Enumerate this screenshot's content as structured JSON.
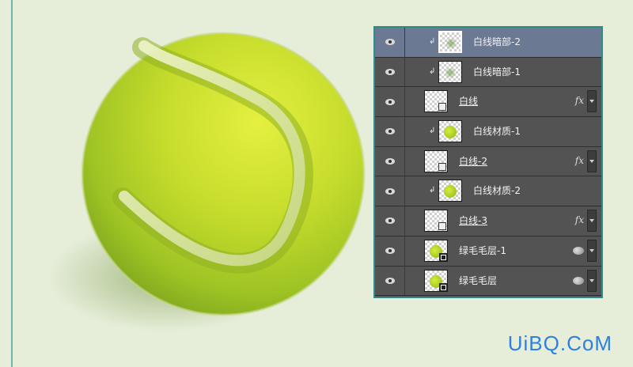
{
  "layers_panel": {
    "rows": [
      {
        "name": "白线暗部-2",
        "selected": true,
        "clipped": true,
        "thumb": "soft",
        "underlined": false,
        "badge": ""
      },
      {
        "name": "白线暗部-1",
        "selected": false,
        "clipped": true,
        "thumb": "soft",
        "underlined": false,
        "badge": ""
      },
      {
        "name": "白线",
        "selected": false,
        "clipped": false,
        "thumb": "shape",
        "underlined": true,
        "badge": "fx"
      },
      {
        "name": "白线材质-1",
        "selected": false,
        "clipped": true,
        "thumb": "ball",
        "underlined": false,
        "badge": ""
      },
      {
        "name": "白线-2",
        "selected": false,
        "clipped": false,
        "thumb": "shape",
        "underlined": true,
        "badge": "fx"
      },
      {
        "name": "白线材质-2",
        "selected": false,
        "clipped": true,
        "thumb": "ball",
        "underlined": false,
        "badge": ""
      },
      {
        "name": "白线-3",
        "selected": false,
        "clipped": false,
        "thumb": "shape",
        "underlined": true,
        "badge": "fx"
      },
      {
        "name": "绿毛毛层-1",
        "selected": false,
        "clipped": false,
        "thumb": "smart",
        "underlined": false,
        "badge": "link"
      },
      {
        "name": "绿毛毛层",
        "selected": false,
        "clipped": false,
        "thumb": "smart",
        "underlined": false,
        "badge": "link"
      }
    ],
    "icons": {
      "visibility": "eye-icon",
      "clip": "clip-arrow-icon",
      "effects": "fx-icon",
      "link": "link-icon",
      "expand": "expand-arrow-icon"
    }
  },
  "watermark": {
    "text": "UiBQ.CoM",
    "color": "#2f7fe0"
  },
  "colors": {
    "background": "#e6eed9",
    "panel_border": "#2e8b8b",
    "ball_light": "#dfee3c",
    "ball_dark": "#8bb322"
  }
}
